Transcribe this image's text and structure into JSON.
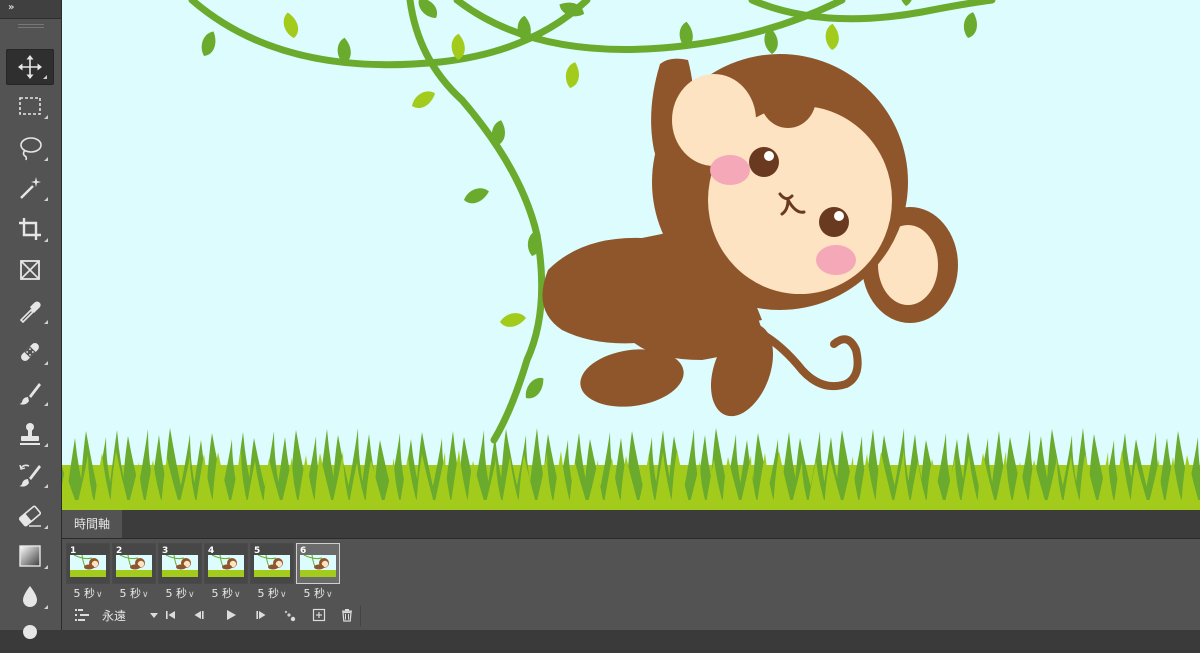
{
  "toolbar": {
    "collapse_glyph": "»",
    "tools": [
      {
        "name": "move-tool",
        "icon": "move-icon",
        "active": true
      },
      {
        "name": "rectangular-marquee-tool",
        "icon": "marquee-icon",
        "active": false
      },
      {
        "name": "lasso-tool",
        "icon": "lasso-icon",
        "active": false
      },
      {
        "name": "magic-wand-tool",
        "icon": "magic-wand-icon",
        "active": false
      },
      {
        "name": "crop-tool",
        "icon": "crop-icon",
        "active": false
      },
      {
        "name": "frame-tool",
        "icon": "frame-icon",
        "active": false
      },
      {
        "name": "eyedropper-tool",
        "icon": "eyedropper-icon",
        "active": false
      },
      {
        "name": "healing-brush-tool",
        "icon": "bandage-icon",
        "active": false
      },
      {
        "name": "brush-tool",
        "icon": "brush-icon",
        "active": false
      },
      {
        "name": "clone-stamp-tool",
        "icon": "stamp-icon",
        "active": false
      },
      {
        "name": "history-brush-tool",
        "icon": "history-brush-icon",
        "active": false
      },
      {
        "name": "eraser-tool",
        "icon": "eraser-icon",
        "active": false
      },
      {
        "name": "gradient-tool",
        "icon": "gradient-icon",
        "active": false
      },
      {
        "name": "blur-tool",
        "icon": "drop-icon",
        "active": false
      },
      {
        "name": "dodge-tool",
        "icon": "dodge-icon",
        "active": false
      }
    ]
  },
  "canvas": {
    "colors": {
      "sky": "#dcfcfd",
      "vine": "#6aaa2c",
      "leaf_dark": "#6aaa2c",
      "leaf_light": "#a3cb1b",
      "monkey_fur": "#8f562b",
      "monkey_face": "#fde3c1",
      "cheek": "#f5a9b8",
      "eye": "#6a3a20",
      "grass_dark": "#6aaa2c",
      "grass_light": "#a3cb1b"
    }
  },
  "timeline": {
    "tab_label": "時間軸",
    "frames": [
      {
        "number": "1",
        "delay": "5 秒",
        "selected": false
      },
      {
        "number": "2",
        "delay": "5 秒",
        "selected": false
      },
      {
        "number": "3",
        "delay": "5 秒",
        "selected": false
      },
      {
        "number": "4",
        "delay": "5 秒",
        "selected": false
      },
      {
        "number": "5",
        "delay": "5 秒",
        "selected": false
      },
      {
        "number": "6",
        "delay": "5 秒",
        "selected": true
      }
    ],
    "loop_option": "永遠",
    "controls": [
      {
        "name": "convert-to-video-timeline-button",
        "icon": "video-timeline-icon"
      },
      {
        "name": "first-frame-button",
        "icon": "first-frame-icon"
      },
      {
        "name": "previous-frame-button",
        "icon": "previous-frame-icon"
      },
      {
        "name": "play-button",
        "icon": "play-icon"
      },
      {
        "name": "next-frame-button",
        "icon": "next-frame-icon"
      },
      {
        "name": "tween-button",
        "icon": "tween-icon"
      },
      {
        "name": "duplicate-frame-button",
        "icon": "new-frame-icon"
      },
      {
        "name": "delete-frame-button",
        "icon": "trash-icon"
      }
    ]
  }
}
